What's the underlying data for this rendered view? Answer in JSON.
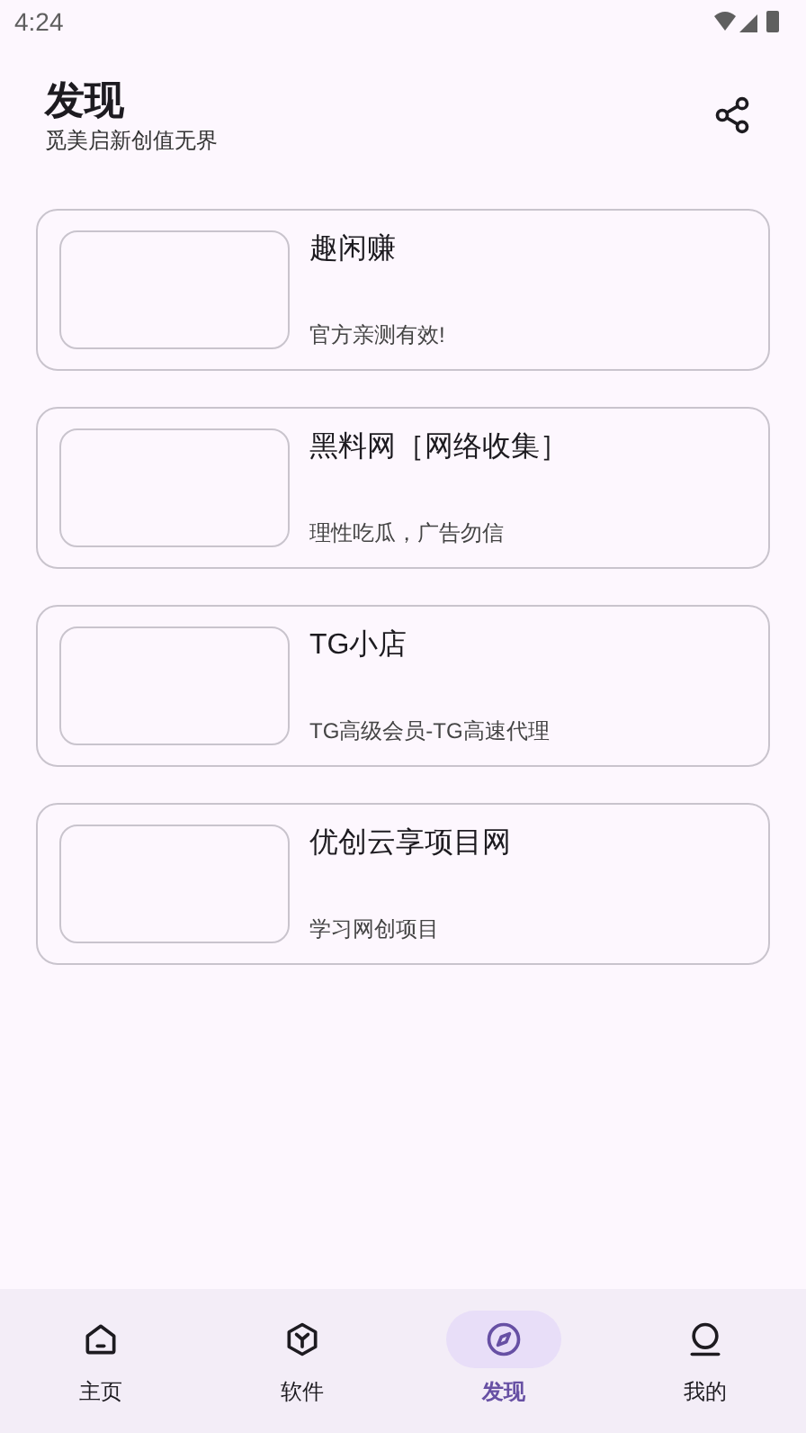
{
  "status_bar": {
    "time": "4:24"
  },
  "header": {
    "title": "发现",
    "subtitle": "觅美启新创值无界"
  },
  "items": [
    {
      "title": "趣闲赚",
      "description": "官方亲测有效!"
    },
    {
      "title": "黑料网［网络收集］",
      "description": "理性吃瓜，广告勿信"
    },
    {
      "title": "TG小店",
      "description": "TG高级会员-TG高速代理"
    },
    {
      "title": "优创云享项目网",
      "description": "学习网创项目"
    }
  ],
  "nav": [
    {
      "label": "主页",
      "selected": false
    },
    {
      "label": "软件",
      "selected": false
    },
    {
      "label": "发现",
      "selected": true
    },
    {
      "label": "我的",
      "selected": false
    }
  ]
}
